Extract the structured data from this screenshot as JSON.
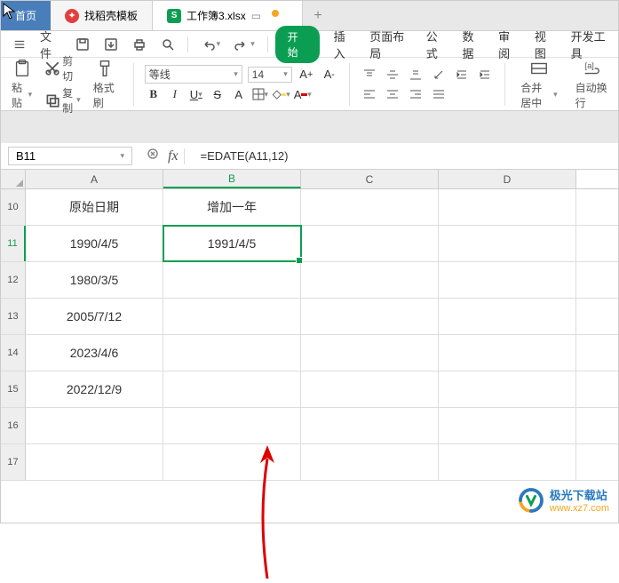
{
  "tabs": {
    "home": "首页",
    "template": "找稻壳模板",
    "doc": "工作簿3.xlsx"
  },
  "filebar": {
    "file": "文件"
  },
  "ribbon_tabs": {
    "start": "开始",
    "insert": "插入",
    "layout": "页面布局",
    "formula": "公式",
    "data": "数据",
    "review": "审阅",
    "view": "视图",
    "dev": "开发工具"
  },
  "ribbon": {
    "paste": "粘贴",
    "cut": "剪切",
    "copy": "复制",
    "format_painter": "格式刷",
    "font_name": "等线",
    "font_size": "14",
    "merge": "合并居中",
    "wrap": "自动换行"
  },
  "namebox": "B11",
  "formula": "=EDATE(A11,12)",
  "columns": {
    "a": "A",
    "b": "B",
    "c": "C",
    "d": "D"
  },
  "row_labels": [
    "10",
    "11",
    "12",
    "13",
    "14",
    "15",
    "16",
    "17"
  ],
  "cells": {
    "A10": "原始日期",
    "B10": "增加一年",
    "A11": "1990/4/5",
    "B11": "1991/4/5",
    "A12": "1980/3/5",
    "A13": "2005/7/12",
    "A14": "2023/4/6",
    "A15": "2022/12/9"
  },
  "watermark": {
    "name": "极光下载站",
    "url": "www.xz7.com"
  },
  "chart_data": {
    "type": "table",
    "columns": [
      "原始日期",
      "增加一年"
    ],
    "rows": [
      [
        "1990/4/5",
        "1991/4/5"
      ],
      [
        "1980/3/5",
        ""
      ],
      [
        "2005/7/12",
        ""
      ],
      [
        "2023/4/6",
        ""
      ],
      [
        "2022/12/9",
        ""
      ]
    ],
    "formula_cell": "B11",
    "formula": "=EDATE(A11,12)"
  }
}
